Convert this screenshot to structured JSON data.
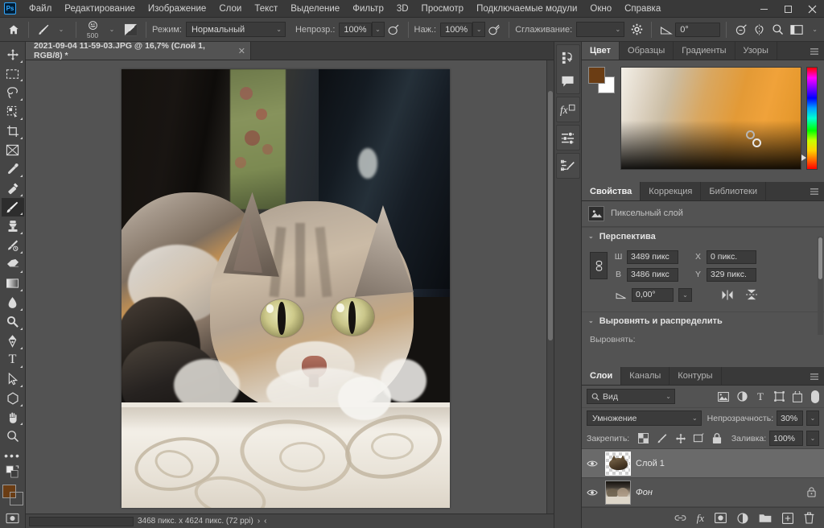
{
  "app": {
    "name": "Ps",
    "logo_bg": "#001e36",
    "logo_fg": "#31a8ff"
  },
  "menubar": {
    "items": [
      {
        "label": "Файл"
      },
      {
        "label": "Редактирование"
      },
      {
        "label": "Изображение"
      },
      {
        "label": "Слои"
      },
      {
        "label": "Текст"
      },
      {
        "label": "Выделение"
      },
      {
        "label": "Фильтр"
      },
      {
        "label": "3D"
      },
      {
        "label": "Просмотр"
      },
      {
        "label": "Подключаемые модули"
      },
      {
        "label": "Окно"
      },
      {
        "label": "Справка"
      }
    ],
    "window_controls": {
      "minimize": "—",
      "maximize": "❐",
      "close": "✕"
    }
  },
  "optionsbar": {
    "home_icon": "home-icon",
    "tool_icon": "brush-tool-icon",
    "brush_size": "500",
    "brush_preset_icon": "brush-tip-icon",
    "blend_toggle_icon": "brush-panel-icon",
    "mode_label": "Режим:",
    "mode_value": "Нормальный",
    "opacity_label": "Непрозр.:",
    "opacity_value": "100%",
    "pressure_opacity_icon": "pressure-opacity-icon",
    "flow_label": "Наж.:",
    "flow_value": "100%",
    "airbrush_icon": "airbrush-icon",
    "smoothing_label": "Сглаживание:",
    "smoothing_value": "",
    "settings_icon": "gear-icon",
    "angle_icon": "brush-angle-icon",
    "angle_value": "0°",
    "pressure_size_icon": "pressure-size-icon",
    "symmetry_icon": "symmetry-icon",
    "search_icon": "search-icon",
    "workspace_icon": "workspace-icon",
    "workspace_caret": "⌄"
  },
  "toolbar": {
    "tools": [
      {
        "name": "move-tool",
        "has_submenu": true
      },
      {
        "name": "rectangular-marquee-tool",
        "has_submenu": true
      },
      {
        "name": "lasso-tool",
        "has_submenu": true
      },
      {
        "name": "quick-selection-tool",
        "has_submenu": true
      },
      {
        "name": "crop-tool",
        "has_submenu": true
      },
      {
        "name": "frame-tool",
        "has_submenu": false
      },
      {
        "name": "eyedropper-tool",
        "has_submenu": true
      },
      {
        "name": "spot-healing-brush-tool",
        "has_submenu": true
      },
      {
        "name": "brush-tool",
        "has_submenu": true,
        "active": true
      },
      {
        "name": "clone-stamp-tool",
        "has_submenu": true
      },
      {
        "name": "history-brush-tool",
        "has_submenu": true
      },
      {
        "name": "eraser-tool",
        "has_submenu": true
      },
      {
        "name": "gradient-tool",
        "has_submenu": true
      },
      {
        "name": "blur-tool",
        "has_submenu": true
      },
      {
        "name": "dodge-tool",
        "has_submenu": true
      },
      {
        "name": "pen-tool",
        "has_submenu": true
      },
      {
        "name": "horizontal-type-tool",
        "has_submenu": true
      },
      {
        "name": "path-selection-tool",
        "has_submenu": true
      },
      {
        "name": "polygon-tool",
        "has_submenu": true
      },
      {
        "name": "hand-tool",
        "has_submenu": true
      },
      {
        "name": "zoom-tool",
        "has_submenu": false
      },
      {
        "name": "edit-toolbar-ellipsis",
        "has_submenu": false
      }
    ],
    "foreground_color": "#6b3d14",
    "background_color": "#ffffff",
    "swap_colors_icon": "swap-colors-icon",
    "quick_mask_icon": "quick-mask-icon"
  },
  "document": {
    "tab_title": "2021-09-04 11-59-03.JPG @ 16,7% (Слой 1, RGB/8) *",
    "close_icon": "✕",
    "zoom": "16,7%",
    "status_size": "3468 пикс. x 4624 пикс. (72 ppi)",
    "status_arrow": "›",
    "status_chevron": "‹"
  },
  "icondock": {
    "groups": [
      {
        "icons": [
          "history-icon",
          "comments-icon"
        ]
      },
      {
        "icons": [
          "layer-styles-fx-icon"
        ]
      },
      {
        "icons": [
          "adjustments-icon"
        ]
      },
      {
        "icons": [
          "brush-settings-icon"
        ]
      }
    ]
  },
  "color_panel": {
    "tabs": [
      {
        "label": "Цвет",
        "active": true
      },
      {
        "label": "Образцы",
        "active": false
      },
      {
        "label": "Градиенты",
        "active": false
      },
      {
        "label": "Узоры",
        "active": false
      }
    ],
    "menu_icon": "panel-menu-icon",
    "foreground": "#6b3d14",
    "background": "#ffffff",
    "ramp_name": "color-ramp",
    "hue_strip_name": "hue-strip"
  },
  "properties_panel": {
    "tabs": [
      {
        "label": "Свойства",
        "active": true
      },
      {
        "label": "Коррекция",
        "active": false
      },
      {
        "label": "Библиотеки",
        "active": false
      }
    ],
    "menu_icon": "panel-menu-icon",
    "layer_type_icon": "pixel-layer-icon",
    "layer_type_label": "Пиксельный слой",
    "transform_section": {
      "title": "Перспектива",
      "chevron": "⌄",
      "link_icon": "link-dimensions-icon",
      "width_label": "Ш",
      "width_value": "3489 пикс",
      "height_label": "В",
      "height_value": "3486 пикс",
      "x_label": "X",
      "x_value": "0 пикс.",
      "y_label": "Y",
      "y_value": "329 пикс.",
      "angle_icon": "angle-icon",
      "angle_value": "0,00°",
      "angle_caret": "⌄",
      "flip_horizontal_icon": "flip-horizontal-icon",
      "flip_vertical_icon": "flip-vertical-icon"
    },
    "align_section": {
      "title": "Выровнять и распределить",
      "chevron": "⌄",
      "align_label": "Выровнять:"
    }
  },
  "layers_panel": {
    "tabs": [
      {
        "label": "Слои",
        "active": true
      },
      {
        "label": "Каналы",
        "active": false
      },
      {
        "label": "Контуры",
        "active": false
      }
    ],
    "menu_icon": "panel-menu-icon",
    "filter": {
      "search_icon": "search-icon",
      "value": "Вид",
      "caret": "⌄",
      "type_icons": [
        "filter-pixel-icon",
        "filter-adjustment-icon",
        "filter-type-icon",
        "filter-shape-icon",
        "filter-smart-object-icon"
      ],
      "toggle_name": "filter-enable-toggle"
    },
    "blend_mode_label": "",
    "blend_mode_value": "Умножение",
    "blend_caret": "⌄",
    "opacity_label": "Непрозрачность:",
    "opacity_value": "30%",
    "opacity_caret": "⌄",
    "lock_label": "Закрепить:",
    "lock_icons": [
      "lock-transparency-icon",
      "lock-image-icon",
      "lock-position-icon",
      "lock-artboard-icon",
      "lock-all-icon"
    ],
    "fill_label": "Заливка:",
    "fill_value": "100%",
    "fill_caret": "⌄",
    "layers": [
      {
        "name": "Слой 1",
        "visible": true,
        "selected": true,
        "locked": false,
        "italic": false,
        "thumb": "layer-thumb-cat-cutout"
      },
      {
        "name": "Фон",
        "visible": true,
        "selected": false,
        "locked": true,
        "italic": true,
        "thumb": "layer-thumb-background-photo"
      }
    ],
    "footer_icons": [
      "link-layers-icon",
      "add-layer-style-fx-icon",
      "add-layer-mask-icon",
      "new-adjustment-layer-icon",
      "new-group-icon",
      "new-layer-icon",
      "delete-layer-icon"
    ]
  },
  "colors": {
    "panel_bg": "#535353",
    "chrome_bg": "#454545",
    "tab_bg": "#393939",
    "accent_blue": "#31a8ff",
    "field_bg": "#3b3b3b",
    "text": "#c8c8c8"
  }
}
